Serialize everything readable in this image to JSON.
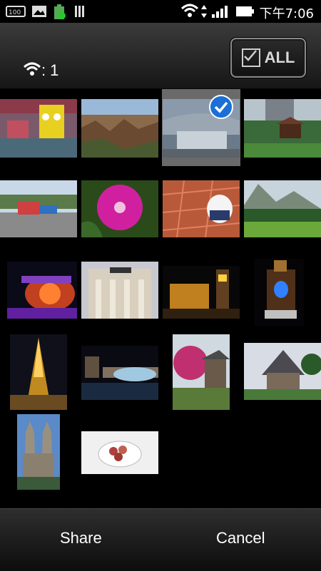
{
  "status_bar": {
    "time": "下午7:06",
    "icons": [
      "battery-100-icon",
      "image-icon",
      "battery-charging-icon",
      "signal-bars-icon",
      "wifi-icon",
      "data-arrows-icon",
      "cell-signal-icon",
      "battery-icon"
    ]
  },
  "header": {
    "selected_count": "1",
    "select_all_label": "ALL"
  },
  "photos": [
    {
      "name": "amusement-park-spongebob",
      "selected": false
    },
    {
      "name": "grand-canyon",
      "selected": false
    },
    {
      "name": "modern-building",
      "selected": true
    },
    {
      "name": "city-gazebo",
      "selected": false
    },
    {
      "name": "playground",
      "selected": false
    },
    {
      "name": "pink-flower",
      "selected": false
    },
    {
      "name": "white-dog-on-bricks",
      "selected": false
    },
    {
      "name": "mountain-meadow",
      "selected": false
    },
    {
      "name": "night-carousel",
      "selected": false
    },
    {
      "name": "caesars-palace",
      "selected": false
    },
    {
      "name": "las-vegas-night-tower",
      "selected": false
    },
    {
      "name": "casino-sign-night",
      "selected": false
    },
    {
      "name": "eiffel-tower-night",
      "selected": false
    },
    {
      "name": "fountain-show-night",
      "selected": false
    },
    {
      "name": "garden-pavilion",
      "selected": false
    },
    {
      "name": "castle-house",
      "selected": false
    },
    {
      "name": "church-towers",
      "selected": false
    },
    {
      "name": "dessert-plate",
      "selected": false
    }
  ],
  "footer": {
    "share_label": "Share",
    "cancel_label": "Cancel"
  }
}
